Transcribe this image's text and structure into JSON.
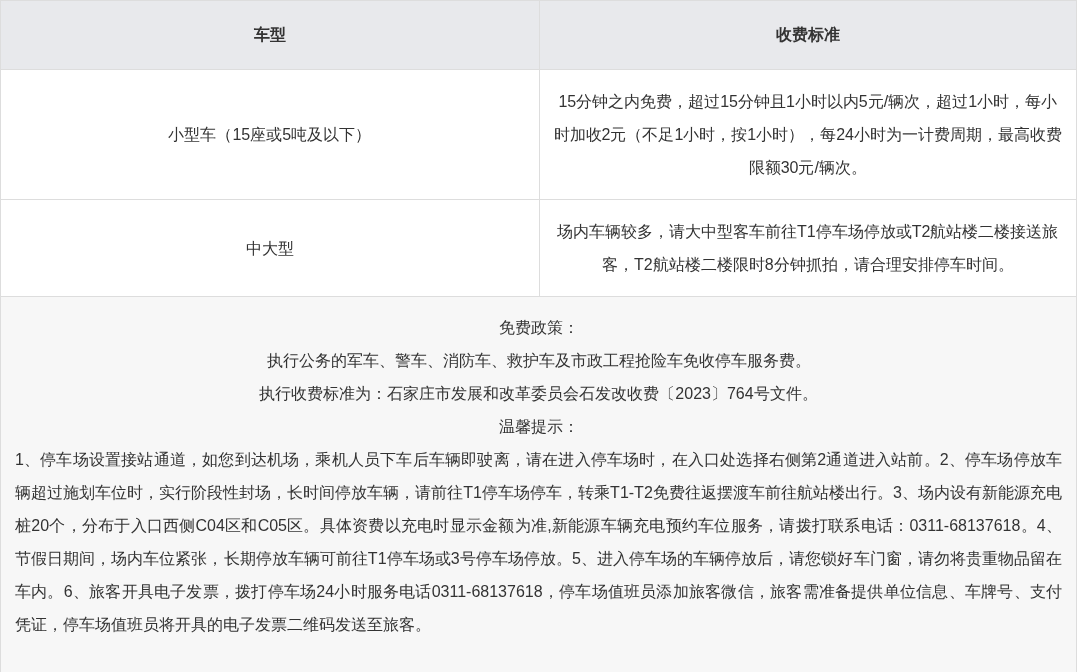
{
  "table": {
    "columns": [
      "车型",
      "收费标准"
    ],
    "rows": [
      {
        "cells": [
          "小型车（15座或5吨及以下）",
          "15分钟之内免费，超过15分钟且1小时以内5元/辆次，超过1小时，每小时加收2元（不足1小时，按1小时），每24小时为一计费周期，最高收费限额30元/辆次。"
        ]
      },
      {
        "cells": [
          "中大型",
          "场内车辆较多，请大中型客车前往T1停车场停放或T2航站楼二楼接送旅客，T2航站楼二楼限时8分钟抓拍，请合理安排停车时间。"
        ]
      }
    ],
    "footer": {
      "lines": [
        "免费政策：",
        "执行公务的军车、警车、消防车、救护车及市政工程抢险车免收停车服务费。",
        "执行收费标准为：石家庄市发展和改革委员会石发改收费〔2023〕764号文件。",
        "温馨提示："
      ],
      "notice": "1、停车场设置接站通道，如您到达机场，乘机人员下车后车辆即驶离，请在进入停车场时，在入口处选择右侧第2通道进入站前。2、停车场停放车辆超过施划车位时，实行阶段性封场，长时间停放车辆，请前往T1停车场停车，转乘T1-T2免费往返摆渡车前往航站楼出行。3、场内设有新能源充电桩20个，分布于入口西侧C04区和C05区。具体资费以充电时显示金额为准,新能源车辆充电预约车位服务，请拨打联系电话：0311-68137618。4、节假日期间，场内车位紧张，长期停放车辆可前往T1停车场或3号停车场停放。5、进入停车场的车辆停放后，请您锁好车门窗，请勿将贵重物品留在车内。6、旅客开具电子发票，拨打停车场24小时服务电话0311-68137618，停车场值班员添加旅客微信，旅客需准备提供单位信息、车牌号、支付凭证，停车场值班员将开具的电子发票二维码发送至旅客。"
    }
  }
}
